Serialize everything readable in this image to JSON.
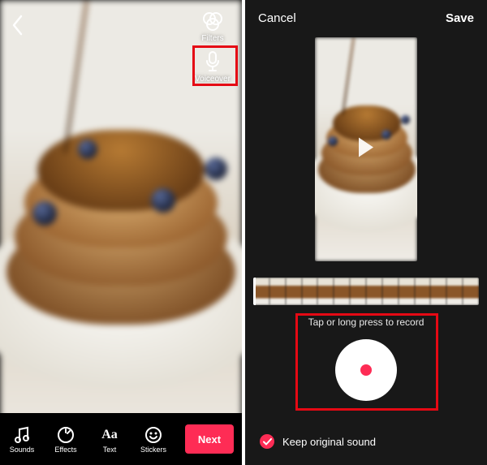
{
  "colors": {
    "accent": "#fe2c55",
    "highlight": "#e50914",
    "dark": "#181818"
  },
  "left": {
    "side": {
      "filters": "Filters",
      "voiceover": "Voiceover"
    },
    "tools": {
      "sounds": "Sounds",
      "effects": "Effects",
      "text": "Text",
      "stickers": "Stickers"
    },
    "next": "Next"
  },
  "right": {
    "cancel": "Cancel",
    "save": "Save",
    "hint": "Tap or long press to record",
    "keep": "Keep original sound"
  }
}
